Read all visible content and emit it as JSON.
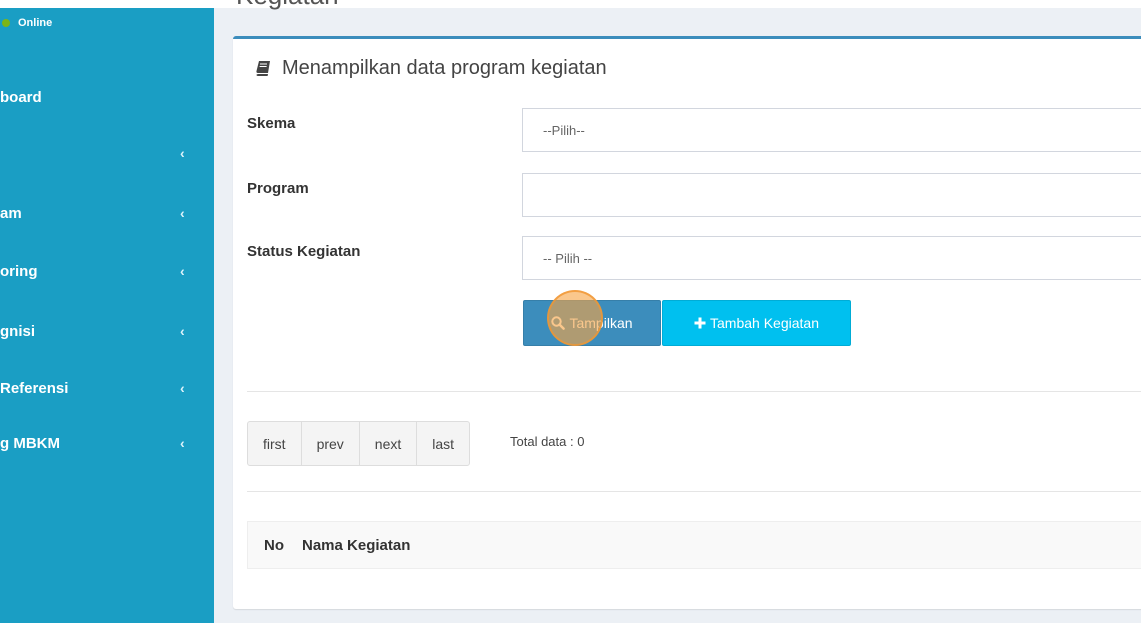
{
  "colors": {
    "sidebar_bg": "#1a9ec4",
    "primary": "#3c8dbc",
    "info": "#00c0ef",
    "status_online": "#7cb518",
    "page_bg": "#ecf0f5"
  },
  "sidebar": {
    "status": "Online",
    "items": [
      {
        "label": "board",
        "has_children": false
      },
      {
        "label": "",
        "has_children": true
      },
      {
        "label": "am",
        "has_children": true
      },
      {
        "label": "oring",
        "has_children": true
      },
      {
        "label": "gnisi",
        "has_children": true
      },
      {
        "label": "Referensi",
        "has_children": true
      },
      {
        "label": "g MBKM",
        "has_children": true
      }
    ],
    "chevron": "‹"
  },
  "page": {
    "title": "Kegiatan"
  },
  "box": {
    "header": "Menampilkan data program kegiatan",
    "header_icon": "book-icon"
  },
  "form": {
    "skema": {
      "label": "Skema",
      "value": "--Pilih--"
    },
    "program": {
      "label": "Program",
      "value": ""
    },
    "status": {
      "label": "Status Kegiatan",
      "value": "-- Pilih --"
    }
  },
  "buttons": {
    "show": {
      "label": "Tampilkan",
      "icon": "search-icon"
    },
    "add": {
      "label": "Tambah Kegiatan",
      "icon": "plus-icon"
    }
  },
  "pagination": {
    "first": "first",
    "prev": "prev",
    "next": "next",
    "last": "last",
    "total": "Total data : 0"
  },
  "table": {
    "columns": [
      "No",
      "Nama Kegiatan"
    ]
  }
}
